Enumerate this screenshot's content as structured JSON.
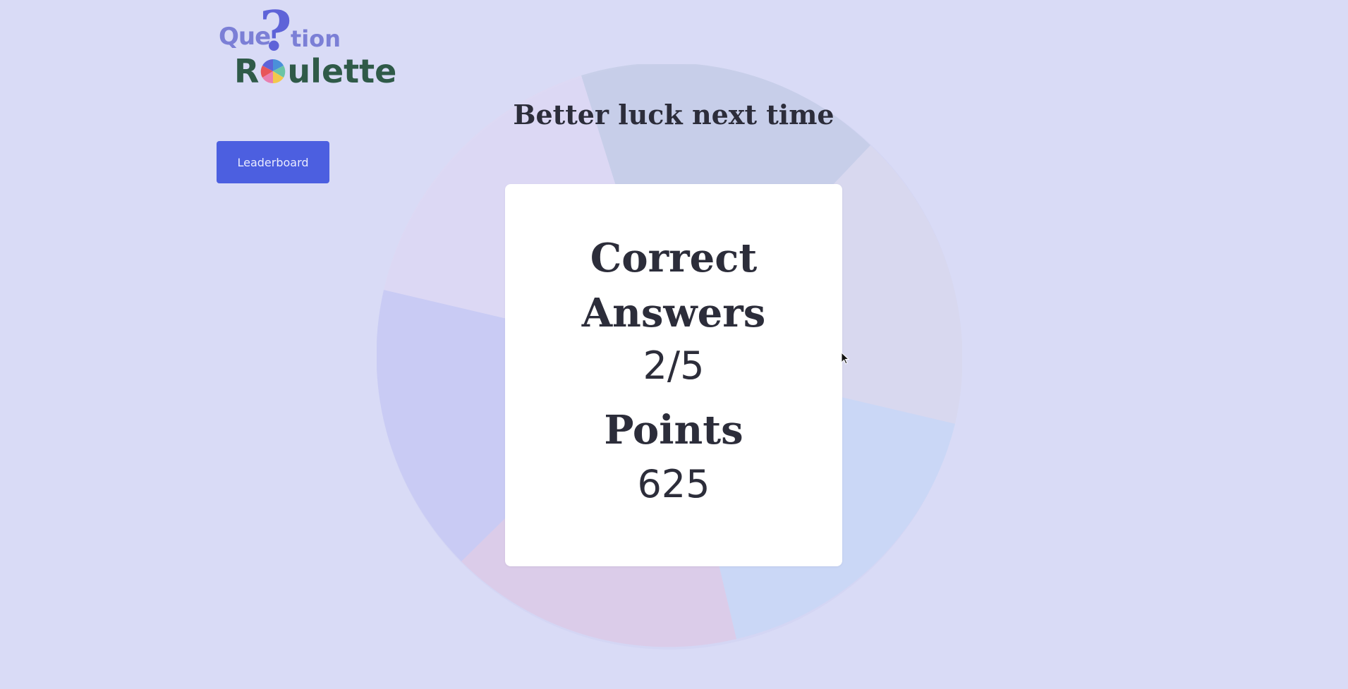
{
  "logo": {
    "top_left": "Que",
    "question_mark": "?",
    "top_right": "tion",
    "bottom_before": "R",
    "bottom_after": "ulette"
  },
  "nav": {
    "leaderboard_label": "Leaderboard"
  },
  "result": {
    "heading": "Better luck next time",
    "correct_label_line1": "Correct",
    "correct_label_line2": "Answers",
    "correct_value": "2/5",
    "points_label": "Points",
    "points_value": "625"
  },
  "colors": {
    "background": "#d9dbf6",
    "button": "#4c5fe0",
    "logo_blue": "#5e63d8",
    "logo_green": "#2f5a48",
    "text": "#2c2d3a"
  },
  "icons": {
    "wheel": "roulette-wheel-icon",
    "cursor": "mouse-pointer-icon"
  }
}
